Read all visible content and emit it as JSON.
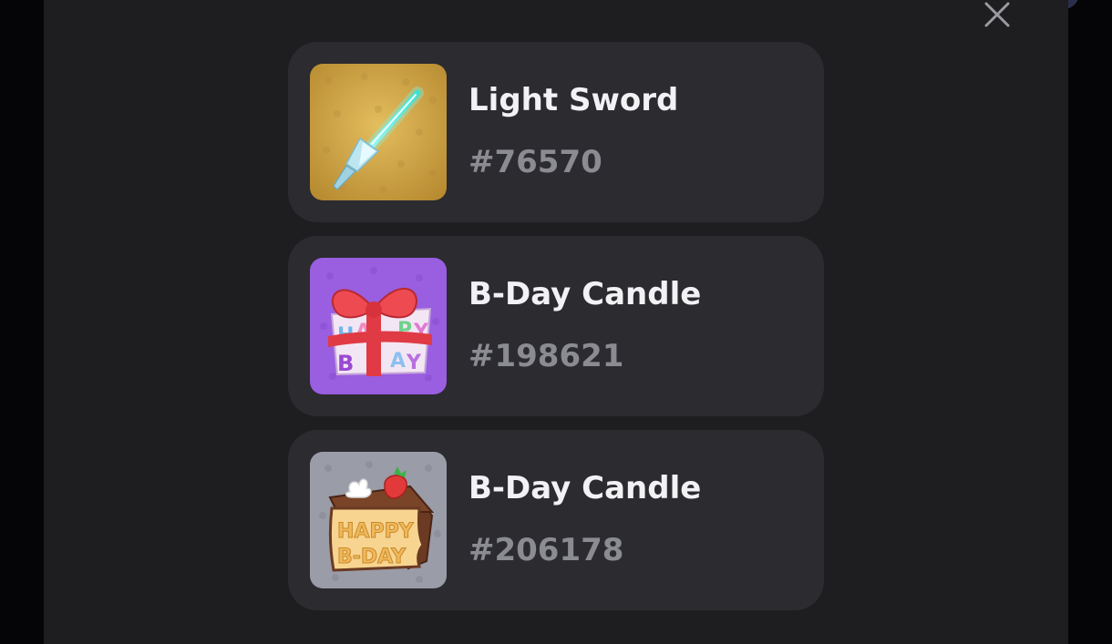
{
  "modal": {
    "close_icon": "close-icon"
  },
  "items": [
    {
      "name": "Light Sword",
      "id": "#76570",
      "icon": "light-sword-icon",
      "bg": "#c99a3c"
    },
    {
      "name": "B-Day Candle",
      "id": "#198621",
      "icon": "gift-box-icon",
      "bg": "#9a5ee0"
    },
    {
      "name": "B-Day Candle",
      "id": "#206178",
      "icon": "birthday-cake-icon",
      "bg": "#9a9ca8"
    }
  ]
}
